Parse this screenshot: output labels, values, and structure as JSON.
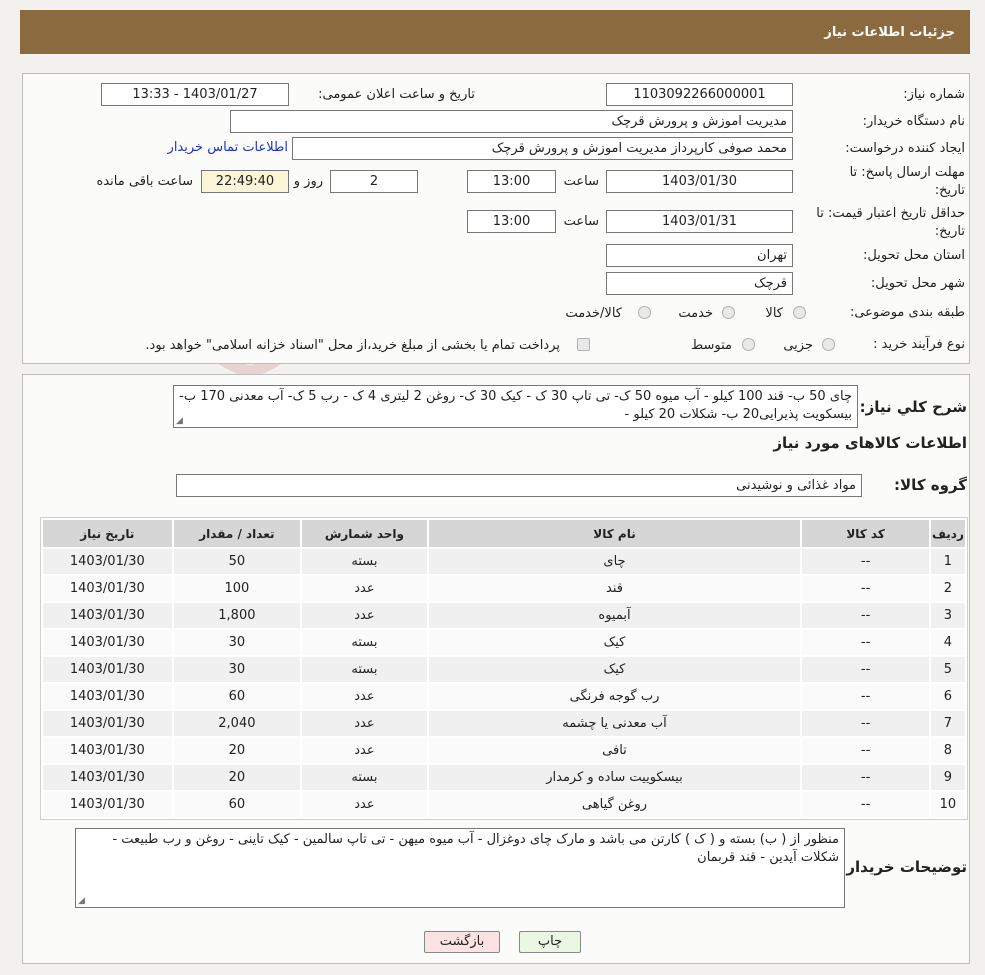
{
  "header": {
    "title": "جزئیات اطلاعات نیاز"
  },
  "form": {
    "need_number_label": "شماره نیاز:",
    "need_number": "1103092266000001",
    "announce_label": "تاریخ و ساعت اعلان عمومی:",
    "announce_value": "1403/01/27 - 13:33",
    "buyer_label": "نام دستگاه خریدار:",
    "buyer_value": "مدیریت اموزش و پرورش قرچک",
    "creator_label": "ایجاد کننده درخواست:",
    "creator_value": "محمد صوفی کارپرداز مدیریت اموزش و پرورش قرچک",
    "contact_link": "اطلاعات تماس خریدار",
    "deadline_label_1": "مهلت ارسال پاسخ: تا",
    "deadline_label_2": "تاریخ:",
    "deadline_date": "1403/01/30",
    "time_label": "ساعت",
    "deadline_time": "13:00",
    "days_value": "2",
    "days_label": "روز و",
    "remaining_time": "22:49:40",
    "remaining_label": "ساعت باقی مانده",
    "validity_label_1": "حداقل تاریخ اعتبار قیمت: تا",
    "validity_label_2": "تاریخ:",
    "validity_date": "1403/01/31",
    "validity_time": "13:00",
    "province_label": "استان محل تحویل:",
    "province_value": "تهران",
    "city_label": "شهر محل تحویل:",
    "city_value": "قرچک",
    "category_label": "طبقه بندی موضوعی:",
    "category_options": [
      "کالا",
      "خدمت",
      "کالا/خدمت"
    ],
    "process_label": "نوع فرآیند خرید :",
    "process_options": [
      "جزیی",
      "متوسط"
    ],
    "process_note": "پرداخت تمام یا بخشی از مبلغ خرید،از محل \"اسناد خزانه اسلامی\" خواهد بود."
  },
  "description": {
    "label": "شرح کلي نیاز:",
    "text": "چای  50 ب- قند 100 کیلو - آب میوه 50 ک- تی تاپ  30 ک - کیک 30 ک- روغن 2 لیتری 4 ک - رب 5 ک- آب معدنی 170 ب- بیسکویت پذیرایی20 ب- شکلات 20 کیلو -"
  },
  "goods": {
    "section_title": "اطلاعات کالاهای مورد نیاز",
    "group_label": "گروه کالا:",
    "group_value": "مواد غذائی و نوشیدنی",
    "columns": [
      "ردیف",
      "کد کالا",
      "نام کالا",
      "واحد شمارش",
      "تعداد / مقدار",
      "تاریخ نیاز"
    ],
    "rows": [
      [
        "1",
        "--",
        "چای",
        "بسته",
        "50",
        "1403/01/30"
      ],
      [
        "2",
        "--",
        "قند",
        "عدد",
        "100",
        "1403/01/30"
      ],
      [
        "3",
        "--",
        "آبمیوه",
        "عدد",
        "1,800",
        "1403/01/30"
      ],
      [
        "4",
        "--",
        "کیک",
        "بسته",
        "30",
        "1403/01/30"
      ],
      [
        "5",
        "--",
        "کیک",
        "بسته",
        "30",
        "1403/01/30"
      ],
      [
        "6",
        "--",
        "رب گوجه فرنگی",
        "عدد",
        "60",
        "1403/01/30"
      ],
      [
        "7",
        "--",
        "آب معدنی یا چشمه",
        "عدد",
        "2,040",
        "1403/01/30"
      ],
      [
        "8",
        "--",
        "تافی",
        "عدد",
        "20",
        "1403/01/30"
      ],
      [
        "9",
        "--",
        "بیسکوییت ساده و کرمدار",
        "بسته",
        "20",
        "1403/01/30"
      ],
      [
        "10",
        "--",
        "روغن گیاهی",
        "عدد",
        "60",
        "1403/01/30"
      ]
    ]
  },
  "buyer_notes": {
    "label": "توضیحات خریدار:",
    "text": "منظور از ( ب) بسته و ( ک ) کارتن می باشد و مارک چای دوغزال - آب میوه میهن - تی تاپ سالمین - کیک تاینی - روغن و رب طبیعت - شکلات آیدین - قند قربمان"
  },
  "buttons": {
    "print": "چاپ",
    "back": "بازگشت"
  },
  "watermark": {
    "text": "AriaTender.neT"
  },
  "colors": {
    "header": "#8b6a3f",
    "link": "#1a35c4",
    "back_button": "#fbe3e3",
    "print_button": "#eaf7e3"
  }
}
